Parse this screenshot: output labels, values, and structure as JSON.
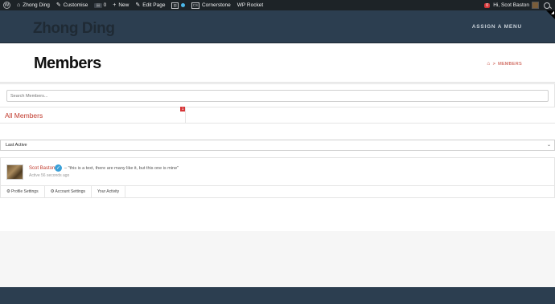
{
  "adminbar": {
    "site_name": "Zhong Ding",
    "customise": "Customise",
    "comments_count": "0",
    "new_label": "New",
    "edit_page": "Edit Page",
    "cornerstone": "Cornerstone",
    "wp_rocket": "WP Rocket",
    "notification_count": "0",
    "greeting": "Hi, Scot Baston"
  },
  "header": {
    "site_title": "Zhong Ding",
    "menu_label": "ASSIGN A MENU"
  },
  "page": {
    "title": "Members",
    "breadcrumb_current": "MEMBERS"
  },
  "directory": {
    "search_placeholder": "Search Members...",
    "tab_all_label": "All Members",
    "tab_all_count": "1",
    "filter_value": "Last Active",
    "member": {
      "name": "Scot Baston",
      "update": "– \"this is a text, there are many like it, but this one is mine\"",
      "active": "Active 56 seconds ago"
    },
    "subnav": {
      "profile_settings": "Profile Settings",
      "account_settings": "Account Settings",
      "your_activity": "Your Activity"
    }
  },
  "colors": {
    "accent": "#c0392b",
    "header_bg": "#2c3e50",
    "adminbar_bg": "#1d2327"
  }
}
